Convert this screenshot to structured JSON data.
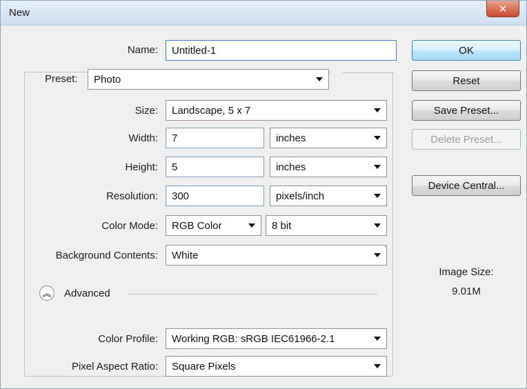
{
  "window": {
    "title": "New"
  },
  "icons": {
    "close": "close-icon",
    "advanced": "collapse-chevrons-icon",
    "dropdown": "chevron-down-icon"
  },
  "colors": {
    "title_bar": "#dbe7f4",
    "close_button": "#c74a2e",
    "default_button": "#bee6fd",
    "focus_border": "#3d7bc9"
  },
  "form": {
    "name": {
      "label": "Name:",
      "value": "Untitled-1"
    },
    "preset": {
      "label": "Preset:",
      "value": "Photo"
    },
    "size": {
      "label": "Size:",
      "value": "Landscape, 5 x 7"
    },
    "width": {
      "label": "Width:",
      "value": "7",
      "unit": "inches"
    },
    "height": {
      "label": "Height:",
      "value": "5",
      "unit": "inches"
    },
    "resolution": {
      "label": "Resolution:",
      "value": "300",
      "unit": "pixels/inch"
    },
    "color_mode": {
      "label": "Color Mode:",
      "mode": "RGB Color",
      "depth": "8 bit"
    },
    "background": {
      "label": "Background Contents:",
      "value": "White"
    },
    "advanced": {
      "label": "Advanced"
    },
    "color_profile": {
      "label": "Color Profile:",
      "value": "Working RGB:  sRGB IEC61966-2.1"
    },
    "pixel_aspect": {
      "label": "Pixel Aspect Ratio:",
      "value": "Square Pixels"
    }
  },
  "buttons": {
    "ok": "OK",
    "reset": "Reset",
    "save_preset": "Save Preset...",
    "delete_preset": "Delete Preset...",
    "device_central": "Device Central..."
  },
  "image_size": {
    "label": "Image Size:",
    "value": "9.01M"
  }
}
